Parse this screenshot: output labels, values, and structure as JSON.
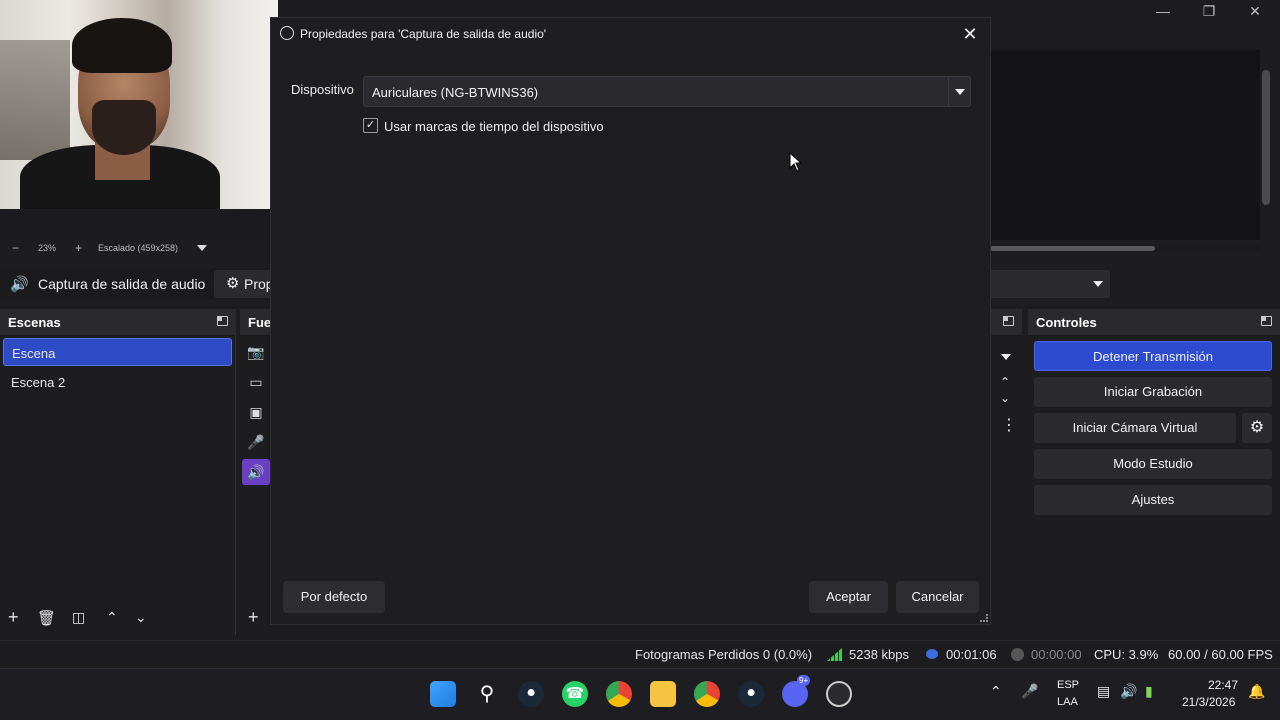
{
  "dialog": {
    "title": "Propiedades para 'Captura de salida de audio'",
    "close_icon": "close-icon",
    "device_label": "Dispositivo",
    "device_value": "Auriculares (NG-BTWINS36)",
    "timestamp_checkbox_label": "Usar marcas de tiempo del dispositivo",
    "timestamp_checked": true,
    "defaults_button": "Por defecto",
    "accept_button": "Aceptar",
    "cancel_button": "Cancelar"
  },
  "preview": {
    "zoom_minus": "−",
    "zoom_value": "23%",
    "zoom_plus": "+",
    "scale_label": "Escalado (459x258)"
  },
  "context_bar": {
    "source_name": "Captura de salida de audio",
    "properties_label": "Prop"
  },
  "scenes": {
    "title": "Escenas",
    "items": [
      "Escena",
      "Escena 2"
    ],
    "active_index": 0
  },
  "sources": {
    "title": "Fue"
  },
  "controls": {
    "title": "Controles",
    "stop_stream": "Detener Transmisión",
    "start_recording": "Iniciar Grabación",
    "start_virtual_cam": "Iniciar Cámara Virtual",
    "studio_mode": "Modo Estudio",
    "settings": "Ajustes"
  },
  "status_bar": {
    "dropped_frames": "Fotogramas Perdidos 0 (0.0%)",
    "bitrate": "5238 kbps",
    "stream_time": "00:01:06",
    "record_time": "00:00:00",
    "cpu": "CPU: 3.9%",
    "fps": "60.00 / 60.00 FPS"
  },
  "taskbar": {
    "language_top": "ESP",
    "language_bottom": "LAA",
    "time": "22:47",
    "date": "21/3/2026",
    "discord_badge": "9+"
  },
  "colors": {
    "accent_blue": "#2e4bc6",
    "source_selected": "#6b3fc2",
    "bitrate_green": "#3ccf4e"
  }
}
